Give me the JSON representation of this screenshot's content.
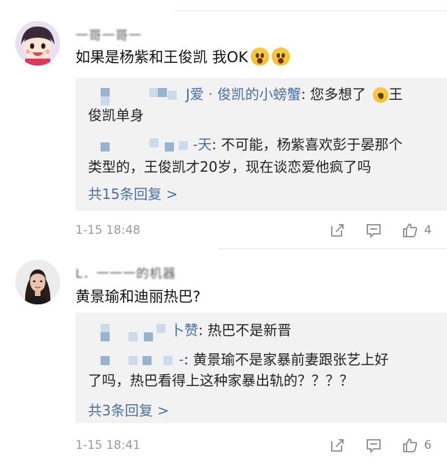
{
  "comments": [
    {
      "username": "一哥一哥一",
      "text": "如果是杨紫和王俊凯 我OK",
      "replies": [
        {
          "name_suffix": "J爱 · 俊凯的小螃蟹",
          "text_line1": ": 您多想了",
          "text_line1_after_emoji": "王",
          "text_line2": "俊凯单身"
        },
        {
          "name_suffix": "-天",
          "text_line1": ": 不可能，杨紫喜欢彭于晏那个",
          "text_line2": "类型的，王俊凯才20岁，现在谈恋爱他疯了吗"
        }
      ],
      "more_replies": "共15条回复 >",
      "time": "1-15 18:48",
      "like_count": "4"
    },
    {
      "username": "L．一一一的机器",
      "text": "黄景瑜和迪丽热巴?",
      "replies": [
        {
          "name_suffix": "卜赞",
          "text_line1": ": 热巴不是新晋"
        },
        {
          "name_suffix": "-",
          "text_line1": ": 黄景瑜不是家暴前妻跟张艺上好",
          "text_line2": "了吗，热巴看得上这种家暴出轨的？？？？"
        }
      ],
      "more_replies": "共3条回复 >",
      "time": "1-15 18:41",
      "like_count": "6"
    }
  ],
  "icons": {
    "share": "share-icon",
    "comment": "comment-icon",
    "like": "thumbs-up-icon"
  },
  "colors": {
    "link": "#4a6fa5",
    "reply_bg": "#f2f2f2",
    "meta": "#9a9a9a"
  }
}
